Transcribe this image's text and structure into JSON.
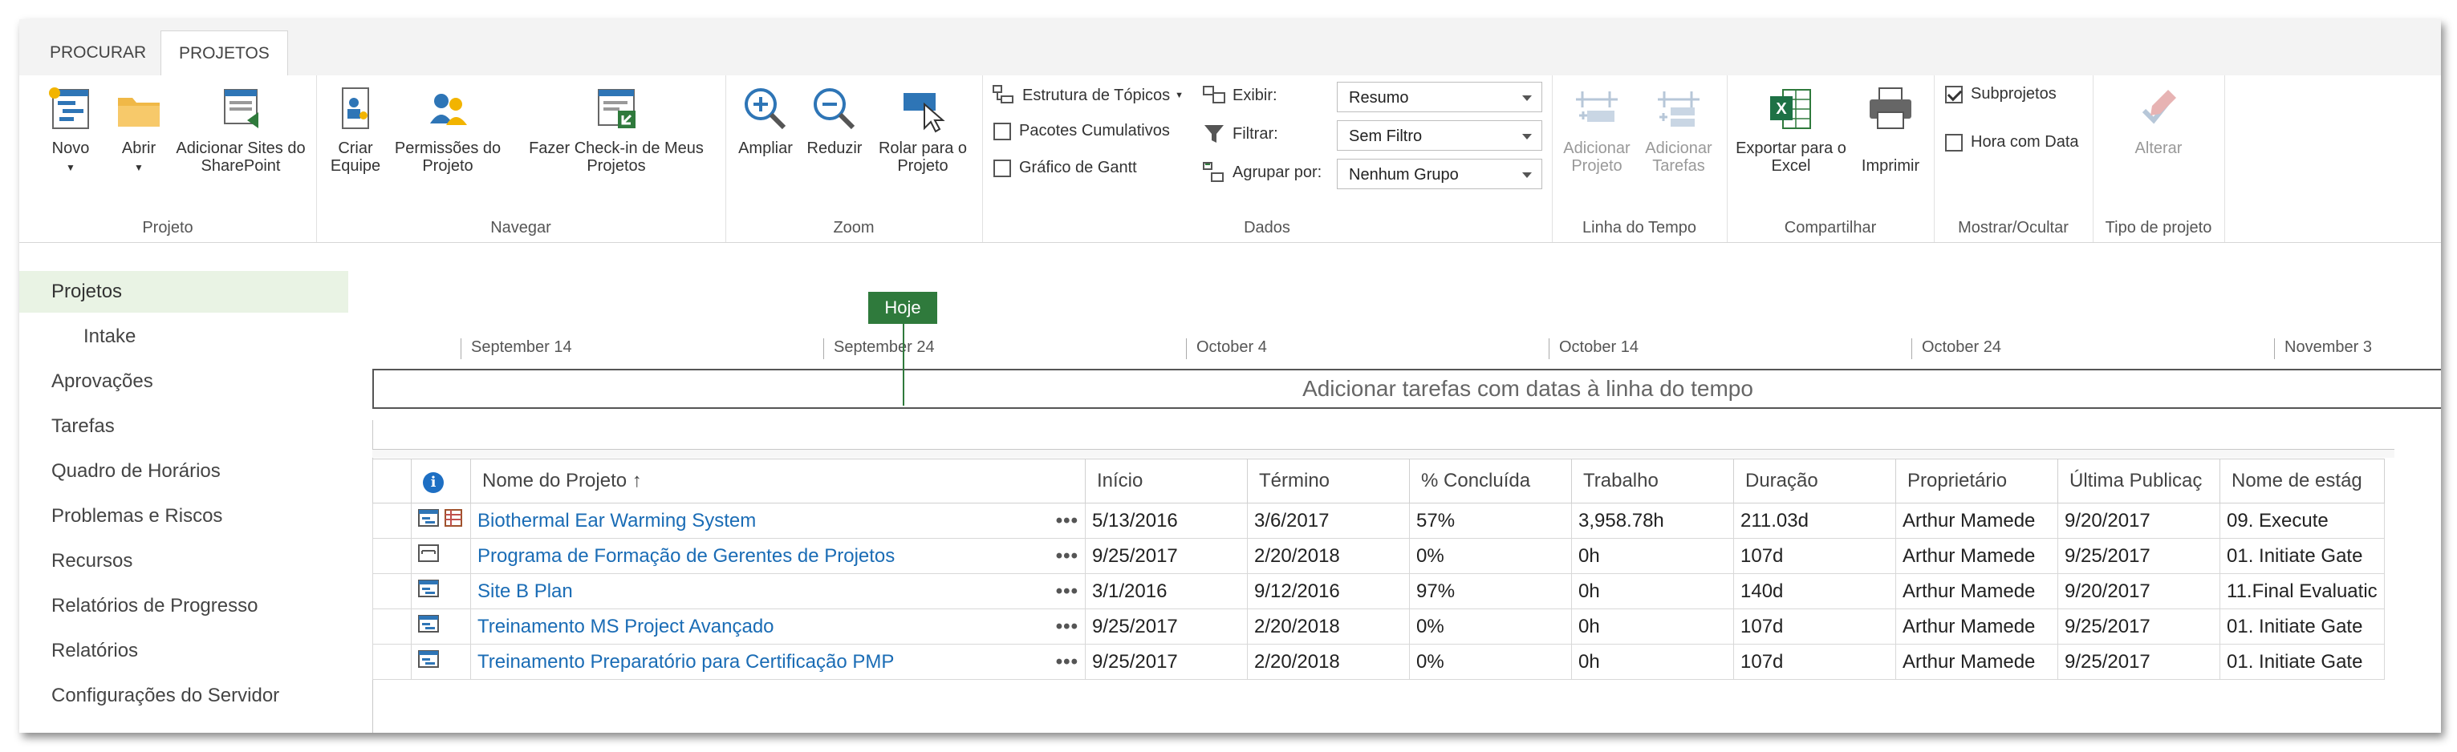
{
  "tabs": [
    {
      "label": "PROCURAR",
      "active": false
    },
    {
      "label": "PROJETOS",
      "active": true
    }
  ],
  "ribbon": {
    "projeto": {
      "label": "Projeto",
      "novo": "Novo",
      "abrir": "Abrir",
      "adicionar_sites_1": "Adicionar Sites do",
      "adicionar_sites_2": "SharePoint"
    },
    "navegar": {
      "label": "Navegar",
      "criar_1": "Criar",
      "criar_2": "Equipe",
      "permissoes_1": "Permissões do",
      "permissoes_2": "Projeto",
      "checkin_1": "Fazer Check-in de Meus",
      "checkin_2": "Projetos"
    },
    "zoom": {
      "label": "Zoom",
      "ampliar": "Ampliar",
      "reduzir": "Reduzir",
      "rolar_1": "Rolar para o",
      "rolar_2": "Projeto"
    },
    "dados": {
      "label": "Dados",
      "estrutura": "Estrutura de Tópicos",
      "pacotes": "Pacotes Cumulativos",
      "gantt": "Gráfico de Gantt",
      "exibir": "Exibir:",
      "filtrar": "Filtrar:",
      "agrupar": "Agrupar por:",
      "exibir_value": "Resumo",
      "filtrar_value": "Sem Filtro",
      "agrupar_value": "Nenhum Grupo",
      "pacotes_checked": false,
      "gantt_checked": false
    },
    "linha": {
      "label": "Linha do Tempo",
      "add_projeto_1": "Adicionar",
      "add_projeto_2": "Projeto",
      "add_tarefas_1": "Adicionar",
      "add_tarefas_2": "Tarefas"
    },
    "compartilhar": {
      "label": "Compartilhar",
      "exportar_1": "Exportar para o",
      "exportar_2": "Excel",
      "imprimir": "Imprimir"
    },
    "mostrar": {
      "label": "Mostrar/Ocultar",
      "subprojetos": "Subprojetos",
      "hora": "Hora com Data",
      "subprojetos_checked": true,
      "hora_checked": false
    },
    "tipo": {
      "label": "Tipo de projeto",
      "alterar": "Alterar"
    }
  },
  "nav": [
    {
      "label": "Projetos",
      "selected": true
    },
    {
      "label": "Intake",
      "sub": true
    },
    {
      "label": "Aprovações"
    },
    {
      "label": "Tarefas"
    },
    {
      "label": "Quadro de Horários"
    },
    {
      "label": "Problemas e Riscos"
    },
    {
      "label": "Recursos"
    },
    {
      "label": "Relatórios de Progresso"
    },
    {
      "label": "Relatórios"
    },
    {
      "label": "Configurações do Servidor"
    }
  ],
  "timeline": {
    "today_label": "Hoje",
    "dates": [
      "September 14",
      "September 24",
      "October 4",
      "October 14",
      "October 24",
      "November 3"
    ],
    "placeholder": "Adicionar tarefas com datas à linha do tempo"
  },
  "grid": {
    "columns": [
      "Nome do Projeto ↑",
      "Início",
      "Término",
      "% Concluída",
      "Trabalho",
      "Duração",
      "Proprietário",
      "Última Publicaç",
      "Nome de estág"
    ],
    "rows": [
      {
        "name": "Biothermal Ear Warming System",
        "inicio": "5/13/2016",
        "termino": "3/6/2017",
        "pct": "57%",
        "trabalho": "3,958.78h",
        "duracao": "211.03d",
        "proprietario": "Arthur Mamede",
        "publicacao": "9/20/2017",
        "estagio": "09. Execute"
      },
      {
        "name": "Programa de Formação de Gerentes de Projetos",
        "inicio": "9/25/2017",
        "termino": "2/20/2018",
        "pct": "0%",
        "trabalho": "0h",
        "duracao": "107d",
        "proprietario": "Arthur Mamede",
        "publicacao": "9/25/2017",
        "estagio": "01. Initiate Gate"
      },
      {
        "name": "Site B Plan",
        "inicio": "3/1/2016",
        "termino": "9/12/2016",
        "pct": "97%",
        "trabalho": "0h",
        "duracao": "140d",
        "proprietario": "Arthur Mamede",
        "publicacao": "9/20/2017",
        "estagio": "11.Final Evaluatic"
      },
      {
        "name": "Treinamento MS Project Avançado",
        "inicio": "9/25/2017",
        "termino": "2/20/2018",
        "pct": "0%",
        "trabalho": "0h",
        "duracao": "107d",
        "proprietario": "Arthur Mamede",
        "publicacao": "9/25/2017",
        "estagio": "01. Initiate Gate"
      },
      {
        "name": "Treinamento Preparatório para Certificação PMP",
        "inicio": "9/25/2017",
        "termino": "2/20/2018",
        "pct": "0%",
        "trabalho": "0h",
        "duracao": "107d",
        "proprietario": "Arthur Mamede",
        "publicacao": "9/25/2017",
        "estagio": "01. Initiate Gate"
      }
    ],
    "ellipsis": "•••"
  },
  "colors": {
    "accent_green": "#2f7a3c",
    "link_blue": "#1a6cb5",
    "nav_selected": "#e9f3e4"
  }
}
